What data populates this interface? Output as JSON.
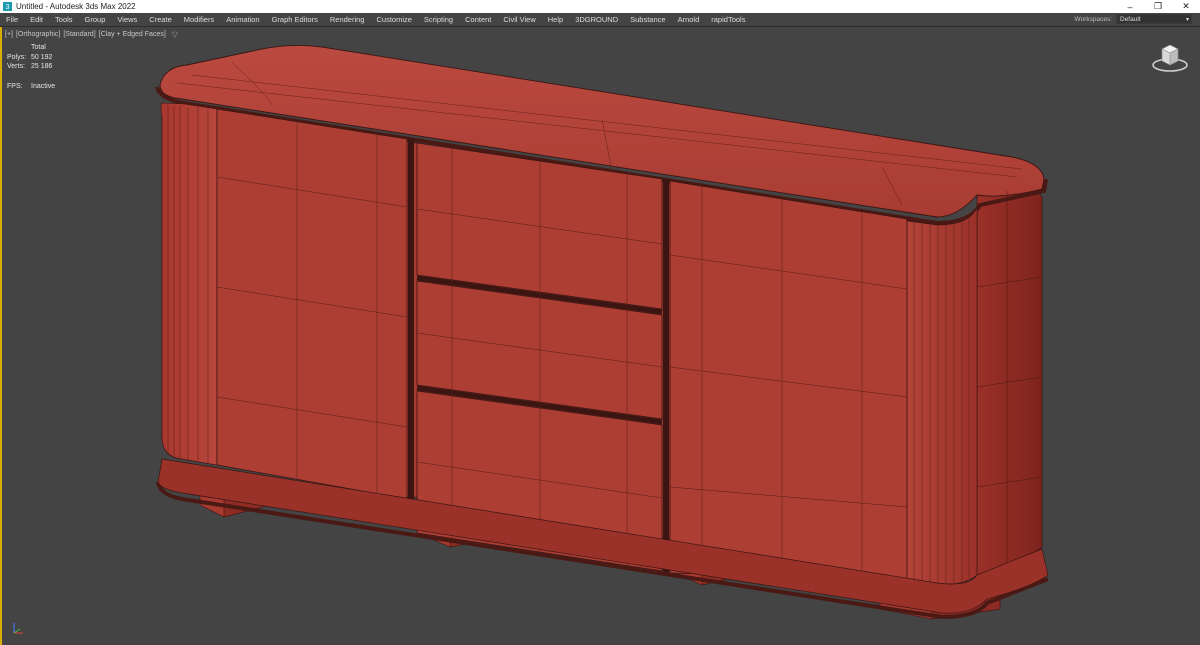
{
  "window": {
    "title": "Untitled - Autodesk 3ds Max 2022",
    "controls": {
      "minimize": "–",
      "maximize": "❐",
      "close": "✕"
    }
  },
  "menu": {
    "items": [
      "File",
      "Edit",
      "Tools",
      "Group",
      "Views",
      "Create",
      "Modifiers",
      "Animation",
      "Graph Editors",
      "Rendering",
      "Customize",
      "Scripting",
      "Content",
      "Civil View",
      "Help",
      "3DGROUND",
      "Substance",
      "Arnold",
      "rapidTools"
    ],
    "workspaces_label": "Workspaces:",
    "workspaces_value": "Default"
  },
  "viewport": {
    "labels": [
      "[+]",
      "[Orthographic]",
      "[Standard]",
      "[Clay + Edged Faces]"
    ],
    "stats": {
      "header": "Total",
      "polys_label": "Polys:",
      "polys_value": "50 192",
      "verts_label": "Verts:",
      "verts_value": "25 186",
      "fps_label": "FPS:",
      "fps_value": "Inactive"
    },
    "active_border_color": "#d5b000",
    "background_color": "#444444",
    "clay_color": "#b5443a"
  }
}
